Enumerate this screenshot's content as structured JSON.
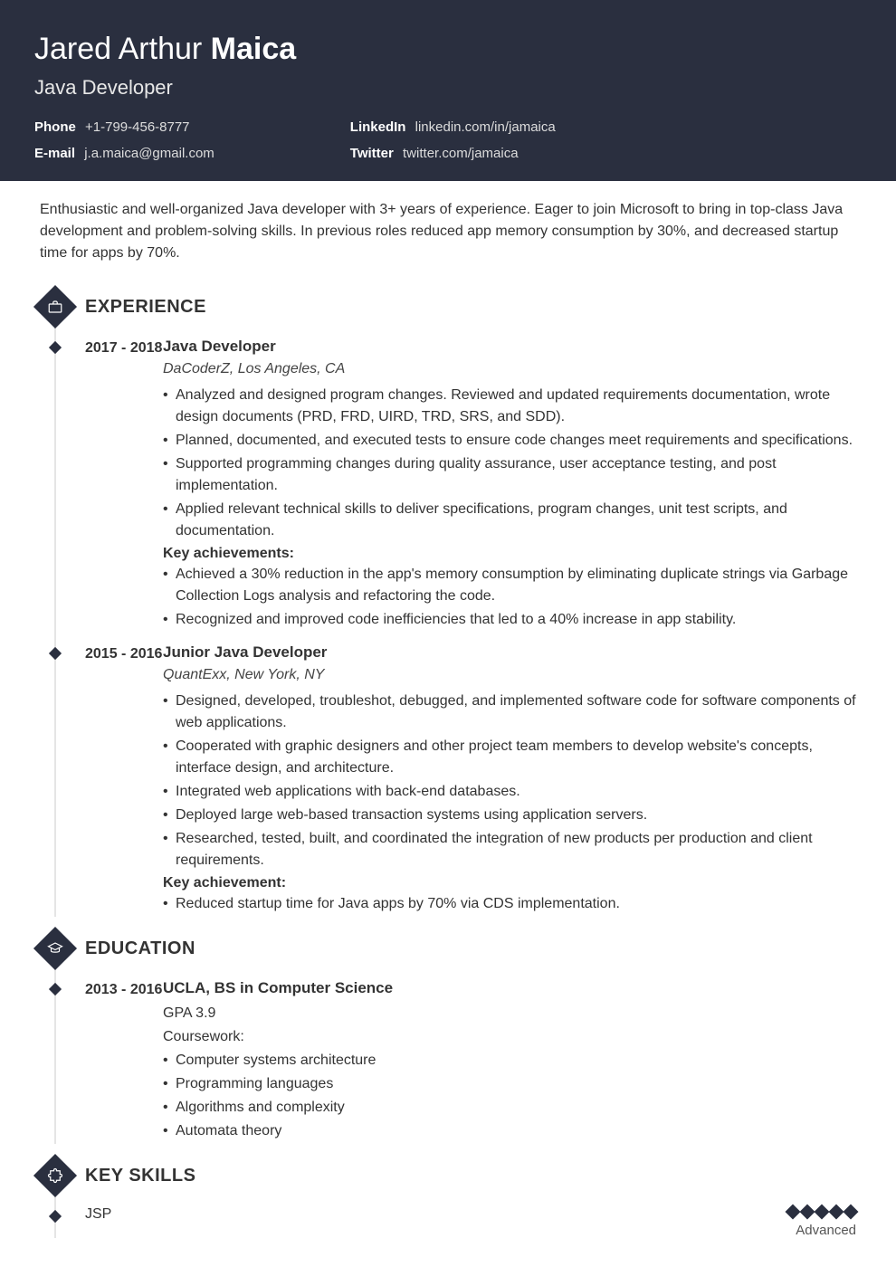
{
  "header": {
    "first_middle": "Jared Arthur ",
    "last": "Maica",
    "title": "Java Developer",
    "contacts": {
      "phone_label": "Phone",
      "phone": "+1-799-456-8777",
      "email_label": "E-mail",
      "email": "j.a.maica@gmail.com",
      "linkedin_label": "LinkedIn",
      "linkedin": "linkedin.com/in/jamaica",
      "twitter_label": "Twitter",
      "twitter": "twitter.com/jamaica"
    }
  },
  "summary": "Enthusiastic and well-organized Java developer with 3+ years of experience. Eager to join Microsoft to bring in top-class Java development and problem-solving skills. In previous roles reduced app memory consumption by 30%, and decreased startup time for apps by 70%.",
  "sections": {
    "experience": {
      "heading": "EXPERIENCE",
      "jobs": [
        {
          "dates": "2017 - 2018",
          "title": "Java Developer",
          "company": "DaCoderZ, Los Angeles, CA",
          "bullets": [
            "Analyzed and designed program changes. Reviewed and updated requirements documentation, wrote design documents (PRD, FRD, UIRD, TRD, SRS, and SDD).",
            "Planned, documented, and executed tests to ensure code changes meet requirements and specifications.",
            "Supported programming changes during quality assurance, user acceptance testing, and post implementation.",
            "Applied relevant technical skills to deliver specifications, program changes, unit test scripts, and documentation."
          ],
          "ach_heading": "Key achievements:",
          "achievements": [
            "Achieved a 30% reduction in the app's memory consumption by eliminating duplicate strings via Garbage Collection Logs analysis and refactoring the code.",
            "Recognized and improved code inefficiencies that led to a 40% increase in app stability."
          ]
        },
        {
          "dates": "2015 - 2016",
          "title": "Junior Java Developer",
          "company": "QuantExx, New York, NY",
          "bullets": [
            "Designed, developed, troubleshot, debugged, and implemented software code for software components of web applications.",
            "Cooperated with graphic designers and other project team members to develop website's concepts, interface design, and architecture.",
            "Integrated web applications with back-end databases.",
            "Deployed large web-based transaction systems using application servers.",
            "Researched, tested, built, and coordinated the integration of new products per production and client requirements."
          ],
          "ach_heading": "Key achievement:",
          "achievements": [
            "Reduced startup time for Java apps by 70% via CDS implementation."
          ]
        }
      ]
    },
    "education": {
      "heading": "EDUCATION",
      "items": [
        {
          "dates": "2013 - 2016",
          "title": "UCLA, BS in Computer Science",
          "gpa": "GPA 3.9",
          "coursework_label": "Coursework:",
          "courses": [
            "Computer systems architecture",
            "Programming languages",
            "Algorithms and complexity",
            "Automata theory"
          ]
        }
      ]
    },
    "skills": {
      "heading": "KEY SKILLS",
      "items": [
        {
          "name": "JSP",
          "level_label": "Advanced",
          "level": 5
        }
      ]
    }
  }
}
